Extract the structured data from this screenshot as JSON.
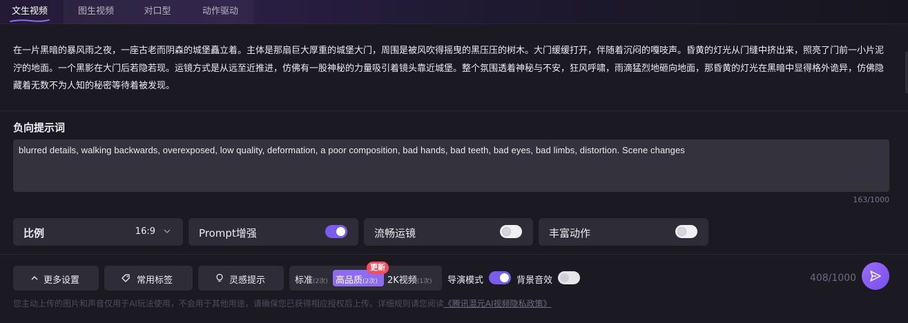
{
  "tabs": [
    {
      "label": "文生视频",
      "active": true
    },
    {
      "label": "图生视频",
      "active": false
    },
    {
      "label": "对口型",
      "active": false
    },
    {
      "label": "动作驱动",
      "active": false
    }
  ],
  "prompt": {
    "text": "在一片黑暗的暴风雨之夜，一座古老而阴森的城堡矗立着。主体是那扇巨大厚重的城堡大门，周围是被风吹得摇曳的黑压压的树木。大门缓缓打开，伴随着沉闷的嘎吱声。昏黄的灯光从门缝中挤出来，照亮了门前一小片泥泞的地面。一个黑影在大门后若隐若现。运镜方式是从远至近推进，仿佛有一股神秘的力量吸引着镜头靠近城堡。整个氛围透着神秘与不安，狂风呼啸，雨滴猛烈地砸向地面，那昏黄的灯光在黑暗中显得格外诡异，仿佛隐藏着无数不为人知的秘密等待着被发现。"
  },
  "negative": {
    "title": "负向提示词",
    "text": "blurred details, walking backwards, overexposed, low quality, deformation, a poor composition, bad hands, bad teeth, bad eyes, bad limbs, distortion. Scene changes",
    "count": "163/1000"
  },
  "options": {
    "ratio_label": "比例",
    "ratio_value": "16:9",
    "prompt_enhance_label": "Prompt增强",
    "prompt_enhance_on": true,
    "smooth_camera_label": "流畅运镜",
    "smooth_camera_on": false,
    "rich_motion_label": "丰富动作",
    "rich_motion_on": false
  },
  "toolbar": {
    "more_settings": "更多设置",
    "common_tags": "常用标签",
    "inspiration": "灵感提示",
    "quality": {
      "standard_label": "标准",
      "standard_cost": "(2次)",
      "high_label": "高品质",
      "high_cost": "(2次)",
      "k2_label": "2K视频",
      "k2_cost": "(1次)",
      "selected": "高品质",
      "badge": "更新"
    },
    "director_mode_label": "导演模式",
    "director_mode_on": true,
    "bg_sound_label": "背景音效",
    "bg_sound_on": false,
    "char_count": "408/1000"
  },
  "disclaimer": {
    "text": "您主动上传的图片和声音仅用于AI玩法使用，不会用于其他用途，请确保您已获得相应授权后上传。详细规则请您阅读",
    "link": "《腾讯混元AI视频隐私政策》"
  },
  "colors": {
    "accent": "#7b5cf0",
    "badge": "#ff4a5b",
    "card": "#2e2c36",
    "background": "#1b1a22"
  }
}
